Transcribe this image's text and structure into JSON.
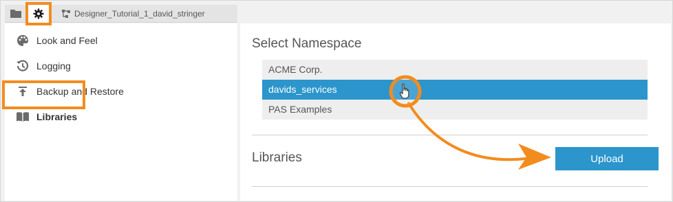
{
  "toolbar": {
    "folder_icon": "folder-icon",
    "settings_icon": "gear-icon",
    "project_icon": "project-tree-icon",
    "project_name": "Designer_Tutorial_1_david_stringer"
  },
  "sidebar": {
    "items": [
      {
        "label": "Look and Feel",
        "icon": "palette-icon"
      },
      {
        "label": "Logging",
        "icon": "history-icon"
      },
      {
        "label": "Backup and Restore",
        "icon": "upload-arrow-icon"
      },
      {
        "label": "Libraries",
        "icon": "book-icon",
        "active": true
      }
    ]
  },
  "main": {
    "namespace_title": "Select Namespace",
    "namespaces": [
      {
        "label": "ACME Corp."
      },
      {
        "label": "davids_services",
        "selected": true
      },
      {
        "label": "PAS Examples"
      }
    ],
    "libraries_title": "Libraries",
    "upload_label": "Upload"
  },
  "colors": {
    "accent": "#2b95cc",
    "highlight": "#f28c1e",
    "background": "#f1f1f1"
  },
  "annotations": {
    "cursor_icon": "hand-pointer-icon",
    "arrow": "curved-arrow"
  }
}
